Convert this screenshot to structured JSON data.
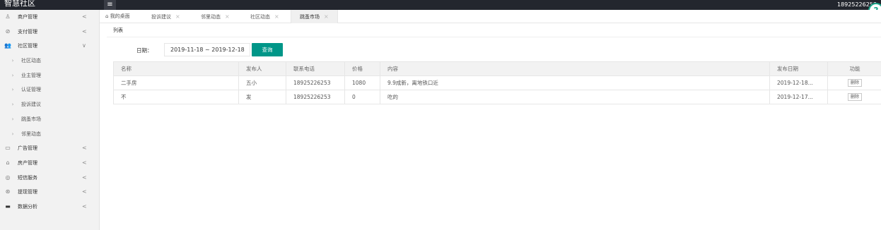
{
  "header": {
    "brand": "智慧社区",
    "menu_icon": "hamburger-icon",
    "user": "18925226253",
    "corner_icon": "question-icon"
  },
  "sidebar": {
    "items": [
      {
        "icon": "user-icon",
        "label": "商户管理",
        "arrow": "<"
      },
      {
        "icon": "circle-check-icon",
        "label": "支付管理",
        "arrow": "<"
      },
      {
        "icon": "users-icon",
        "label": "社区管理",
        "arrow": "∨"
      },
      {
        "icon": "chevron-right-icon",
        "label": "社区动态",
        "arrow": ""
      },
      {
        "icon": "chevron-right-icon",
        "label": "业主管理",
        "arrow": ""
      },
      {
        "icon": "chevron-right-icon",
        "label": "认证管理",
        "arrow": ""
      },
      {
        "icon": "chevron-right-icon",
        "label": "投诉建议",
        "arrow": ""
      },
      {
        "icon": "chevron-right-icon",
        "label": "跳蚤市场",
        "arrow": ""
      },
      {
        "icon": "chevron-right-icon",
        "label": "邻里动态",
        "arrow": ""
      },
      {
        "icon": "ad-icon",
        "label": "广告管理",
        "arrow": "<"
      },
      {
        "icon": "home-icon",
        "label": "房产管理",
        "arrow": "<"
      },
      {
        "icon": "message-icon",
        "label": "短信服务",
        "arrow": "<"
      },
      {
        "icon": "withdraw-icon",
        "label": "提现管理",
        "arrow": "<"
      },
      {
        "icon": "chart-icon",
        "label": "数据分析",
        "arrow": "<"
      }
    ]
  },
  "tabs": [
    {
      "label": "我的桌面",
      "close": "",
      "icon": "home-icon"
    },
    {
      "label": "投诉建议",
      "close": "×"
    },
    {
      "label": "邻里动态",
      "close": "×"
    },
    {
      "label": "社区动态",
      "close": "×"
    },
    {
      "label": "跳蚤市场",
      "close": "×",
      "active": true
    }
  ],
  "main": {
    "card_title": "列表",
    "date_label": "日期：",
    "date_value": "2019-11-18 ~ 2019-12-18",
    "query_label": "查询",
    "table": {
      "columns": [
        "名称",
        "发布人",
        "联系电话",
        "价格",
        "内容",
        "发布日期",
        "功能"
      ],
      "rows": [
        [
          "二手房",
          "五小",
          "18925226253",
          "1080",
          "9.9成新，离地铁口近",
          "2019-12-18...",
          "删除"
        ],
        [
          "不",
          "发",
          "18925226253",
          "0",
          "吃的",
          "2019-12-17...",
          "删除"
        ]
      ]
    }
  },
  "colors": {
    "topbar": "#23262e",
    "accent": "#009688",
    "sidebar_bg": "#f2f2f2"
  }
}
